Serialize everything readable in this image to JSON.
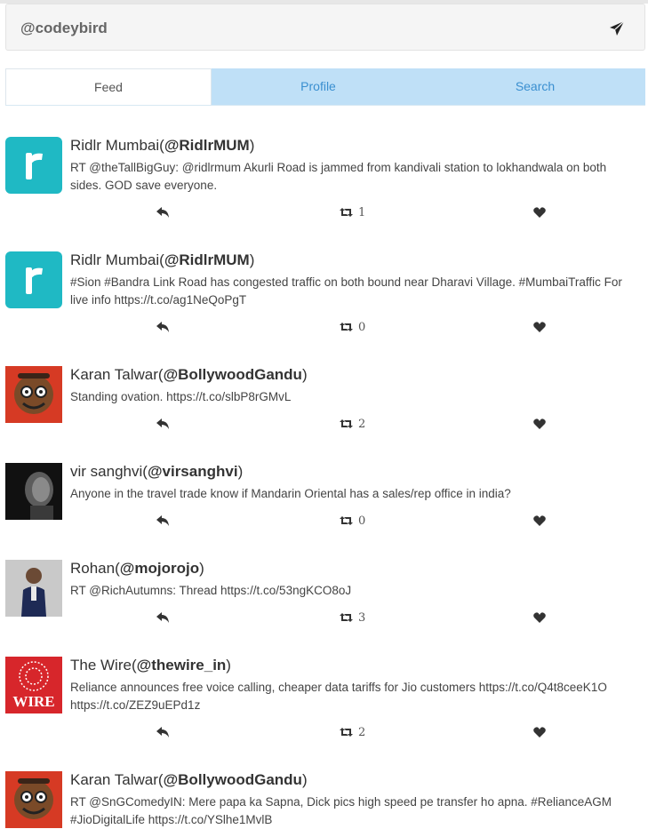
{
  "compose": {
    "handle": "@codeybird",
    "send_icon": "paper-plane-icon"
  },
  "tabs": [
    {
      "label": "Feed",
      "active": true
    },
    {
      "label": "Profile",
      "active": false
    },
    {
      "label": "Search",
      "active": false
    }
  ],
  "tweets": [
    {
      "name": "Ridlr Mumbai",
      "handle": "@RidlrMUM",
      "text": "RT @theTallBigGuy: @ridlrmum Akurli Road is jammed from kandivali station to lokhandwala on both sides. GOD save everyone.",
      "retweets": "1",
      "avatar": "ridlr-logo"
    },
    {
      "name": "Ridlr Mumbai",
      "handle": "@RidlrMUM",
      "text": "#Sion #Bandra Link Road has congested traffic on both bound near Dharavi Village. #MumbaiTraffic For live info https://t.co/ag1NeQoPgT",
      "retweets": "0",
      "avatar": "ridlr-logo"
    },
    {
      "name": "Karan Talwar",
      "handle": "@BollywoodGandu",
      "text": "Standing ovation. https://t.co/slbP8rGMvL",
      "retweets": "2",
      "avatar": "cartoon-face"
    },
    {
      "name": "vir sanghvi",
      "handle": "@virsanghvi",
      "text": "Anyone in the travel trade know if Mandarin Oriental has a sales/rep office in india?",
      "retweets": "0",
      "avatar": "portrait-dark"
    },
    {
      "name": "Rohan",
      "handle": "@mojorojo",
      "text": "RT @RichAutumns: Thread https://t.co/53ngKCO8oJ",
      "retweets": "3",
      "avatar": "person-suit"
    },
    {
      "name": "The Wire",
      "handle": "@thewire_in",
      "text": "Reliance announces free voice calling, cheaper data tariffs for Jio customers https://t.co/Q4t8ceeK1O https://t.co/ZEZ9uEPd1z",
      "retweets": "2",
      "avatar": "wire-logo"
    },
    {
      "name": "Karan Talwar",
      "handle": "@BollywoodGandu",
      "text": "RT @SnGComedyIN: Mere papa ka Sapna, Dick pics high speed pe transfer ho apna. #RelianceAGM #JioDigitalLife https://t.co/YSlhe1MvlB",
      "retweets": "",
      "avatar": "cartoon-face"
    }
  ],
  "icons": {
    "reply": "reply-icon",
    "retweet": "retweet-icon",
    "like": "heart-icon"
  },
  "colors": {
    "tab_bar": "#bfe0f7",
    "tab_link": "#3a8fd0",
    "ridlr_teal": "#1fb9c4",
    "wire_red": "#d7262b"
  }
}
